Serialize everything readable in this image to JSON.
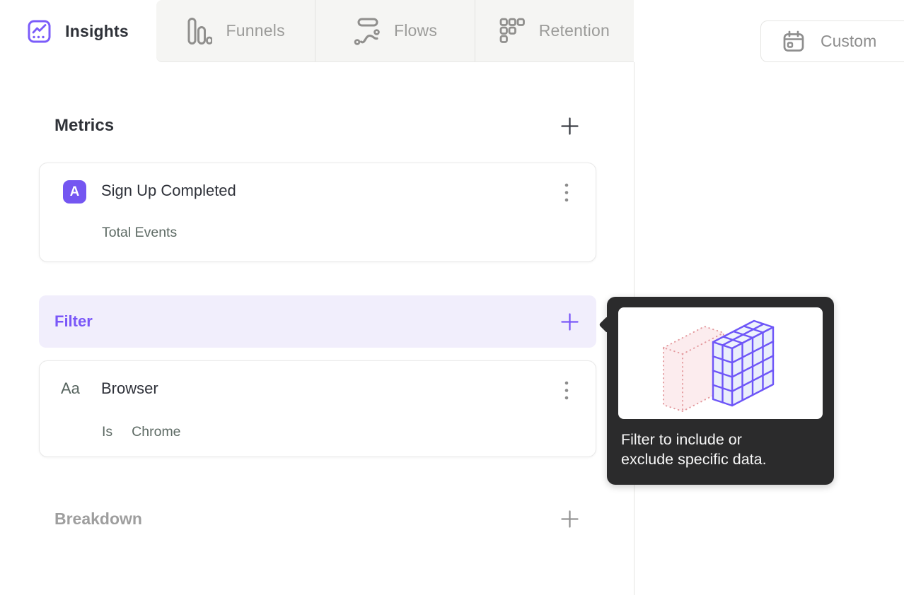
{
  "tabs": [
    {
      "label": "Insights",
      "active": true
    },
    {
      "label": "Funnels",
      "active": false
    },
    {
      "label": "Flows",
      "active": false
    },
    {
      "label": "Retention",
      "active": false
    }
  ],
  "date_picker": {
    "label": "Custom"
  },
  "metrics": {
    "heading": "Metrics",
    "add_icon": "plus-icon",
    "card": {
      "badge": "A",
      "title": "Sign Up Completed",
      "subtitle": "Total Events",
      "menu_icon": "kebab-menu-icon"
    }
  },
  "filter": {
    "heading": "Filter",
    "add_icon": "plus-icon",
    "card": {
      "type_glyph": "Aa",
      "title": "Browser",
      "operator": "Is",
      "value": "Chrome",
      "menu_icon": "kebab-menu-icon"
    }
  },
  "breakdown": {
    "heading": "Breakdown",
    "add_icon": "plus-icon"
  },
  "tooltip": {
    "line1": "Filter to include or",
    "line2": "exclude specific data.",
    "illustration": "filter-cube-illustration"
  },
  "colors": {
    "accent_purple": "#7456f1",
    "filter_text_purple": "#7a57f8",
    "filter_row_bg": "#f1eefc",
    "tooltip_bg": "#2b2b2c",
    "inactive_tab_bg": "#f5f5f3",
    "inactive_tab_text": "#9b9b99",
    "dark_text": "#2f323a",
    "muted_text": "#5d6a64",
    "illustration_pink": "#e49b9f",
    "illustration_purple": "#6e56f8"
  }
}
